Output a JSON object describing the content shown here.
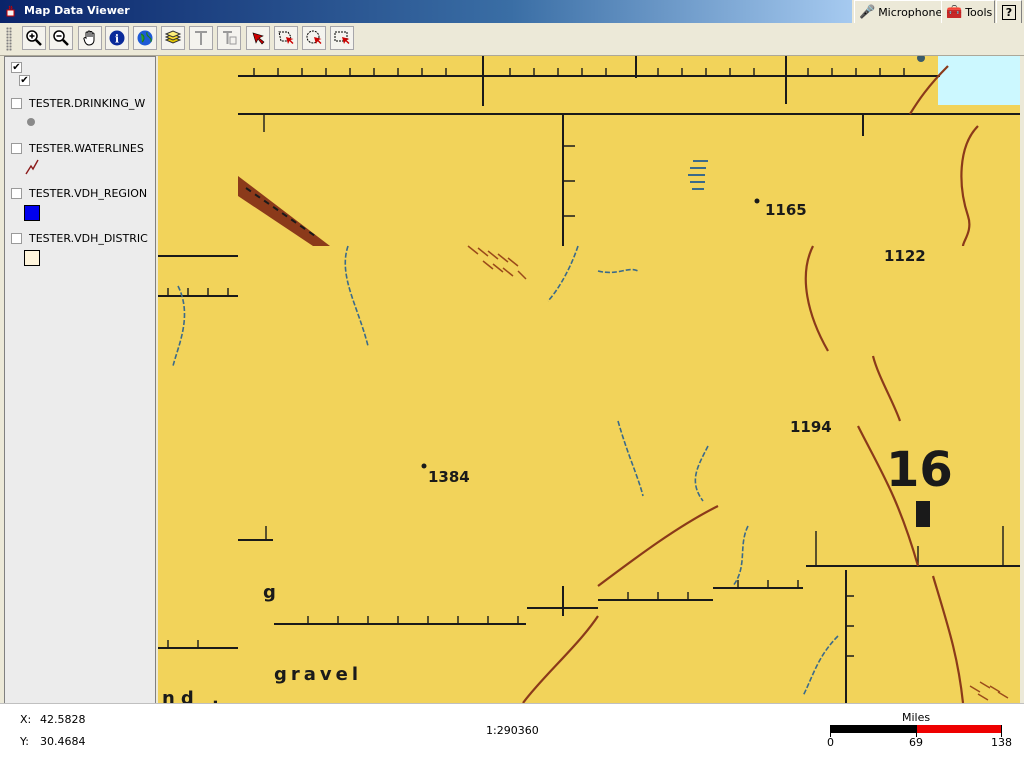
{
  "window": {
    "title": "Map Data Viewer"
  },
  "tabs": [
    {
      "label": "Microphone",
      "icon": "microphone-icon"
    },
    {
      "label": "Tools",
      "icon": "tools-icon"
    },
    {
      "label": "?",
      "icon": "help-icon"
    }
  ],
  "toolbar": [
    {
      "name": "zoom-in-icon"
    },
    {
      "name": "zoom-out-icon"
    },
    {
      "name": "pan-hand-icon"
    },
    {
      "name": "info-icon"
    },
    {
      "name": "globe-icon"
    },
    {
      "name": "layers-icon"
    },
    {
      "name": "text-icon"
    },
    {
      "name": "text-box-icon"
    },
    {
      "name": "select-arrow-icon"
    },
    {
      "name": "select-region-icon"
    },
    {
      "name": "select-circle-icon"
    },
    {
      "name": "select-rectangle-icon"
    }
  ],
  "layers": [
    {
      "label": "TESTER.DRINKING_W",
      "checked": false,
      "symbol": "point"
    },
    {
      "label": "TESTER.WATERLINES",
      "checked": false,
      "symbol": "line"
    },
    {
      "label": "TESTER.VDH_REGION",
      "checked": false,
      "symbol": "blue-fill"
    },
    {
      "label": "TESTER.VDH_DISTRIC",
      "checked": false,
      "symbol": "cream-fill"
    }
  ],
  "map_labels": {
    "l1165": "1165",
    "l1122": "1122",
    "l1194": "1194",
    "l1384": "1384",
    "l16": "16",
    "lg": "g",
    "lgravel": "gravel",
    "lnd": "nd ."
  },
  "status": {
    "x_label": "X:",
    "x_value": "42.5828",
    "y_label": "Y:",
    "y_value": "30.4684",
    "scale": "1:290360",
    "scalebar_title": "Miles",
    "tick0": "0",
    "tick1": "69",
    "tick2": "138"
  },
  "colors": {
    "map_bg": "#f2d35a",
    "scale_black": "#000000",
    "scale_red": "#ee0000",
    "region_blue": "#0000ee",
    "district_cream": "#fff5dc"
  }
}
